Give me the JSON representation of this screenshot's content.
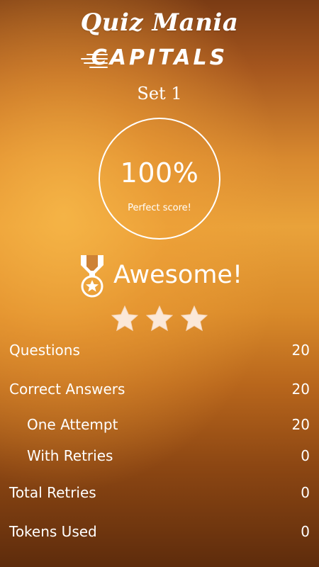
{
  "header": {
    "app_title": "Quiz Mania",
    "subtitle": "CAPITALS",
    "set_label": "Set 1"
  },
  "score": {
    "percent_text": "100%",
    "caption": "Perfect score!"
  },
  "result": {
    "icon": "medal-icon",
    "text": "Awesome!",
    "stars_earned": 3,
    "stars_total": 3
  },
  "stats": [
    {
      "label": "Questions",
      "value": "20"
    },
    {
      "label": "Correct Answers",
      "value": "20"
    },
    {
      "label": "One Attempt",
      "value": "20"
    },
    {
      "label": "With Retries",
      "value": "0"
    },
    {
      "label": "Total Retries",
      "value": "0"
    },
    {
      "label": "Tokens Used",
      "value": "0"
    }
  ],
  "colors": {
    "text": "#ffffff",
    "star_fill": "#fbe8d8",
    "background_light": "#e9a23a",
    "background_dark": "#5e2c0c"
  }
}
